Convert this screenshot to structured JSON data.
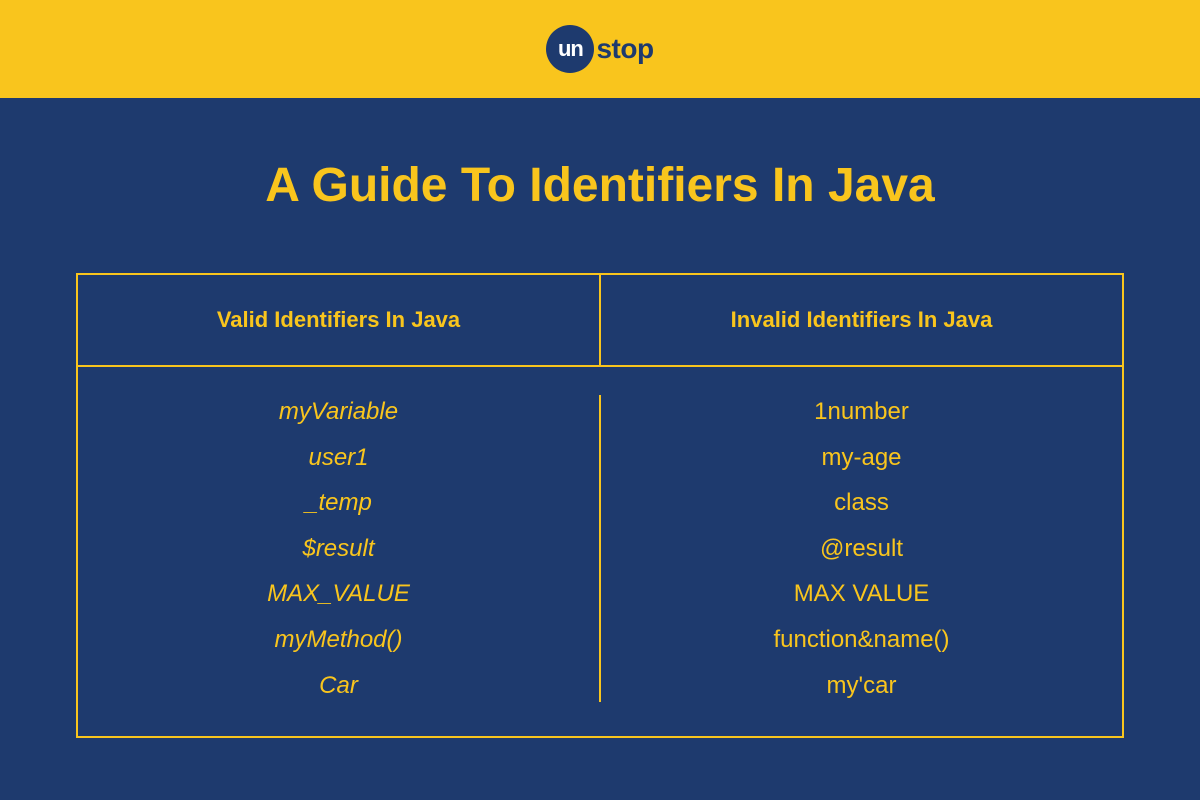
{
  "brand": {
    "circle_text": "un",
    "suffix_text": "stop"
  },
  "title": "A Guide To Identifiers In Java",
  "columns": [
    {
      "header": "Valid Identifiers In Java",
      "italic": true
    },
    {
      "header": "Invalid Identifiers In Java",
      "italic": false
    }
  ],
  "valid_items": [
    "myVariable",
    "user1",
    "_temp",
    "$result",
    "MAX_VALUE",
    "myMethod()",
    "Car"
  ],
  "invalid_items": [
    "1number",
    "my-age",
    "class",
    "@result",
    "MAX VALUE",
    "function&name()",
    "my'car"
  ],
  "chart_data": {
    "type": "table",
    "title": "A Guide To Identifiers In Java",
    "columns": [
      "Valid Identifiers In Java",
      "Invalid Identifiers In Java"
    ],
    "rows": [
      [
        "myVariable",
        "1number"
      ],
      [
        "user1",
        "my-age"
      ],
      [
        "_temp",
        "class"
      ],
      [
        "$result",
        "@result"
      ],
      [
        "MAX_VALUE",
        "MAX VALUE"
      ],
      [
        "myMethod()",
        "function&name()"
      ],
      [
        "Car",
        "my'car"
      ]
    ]
  }
}
